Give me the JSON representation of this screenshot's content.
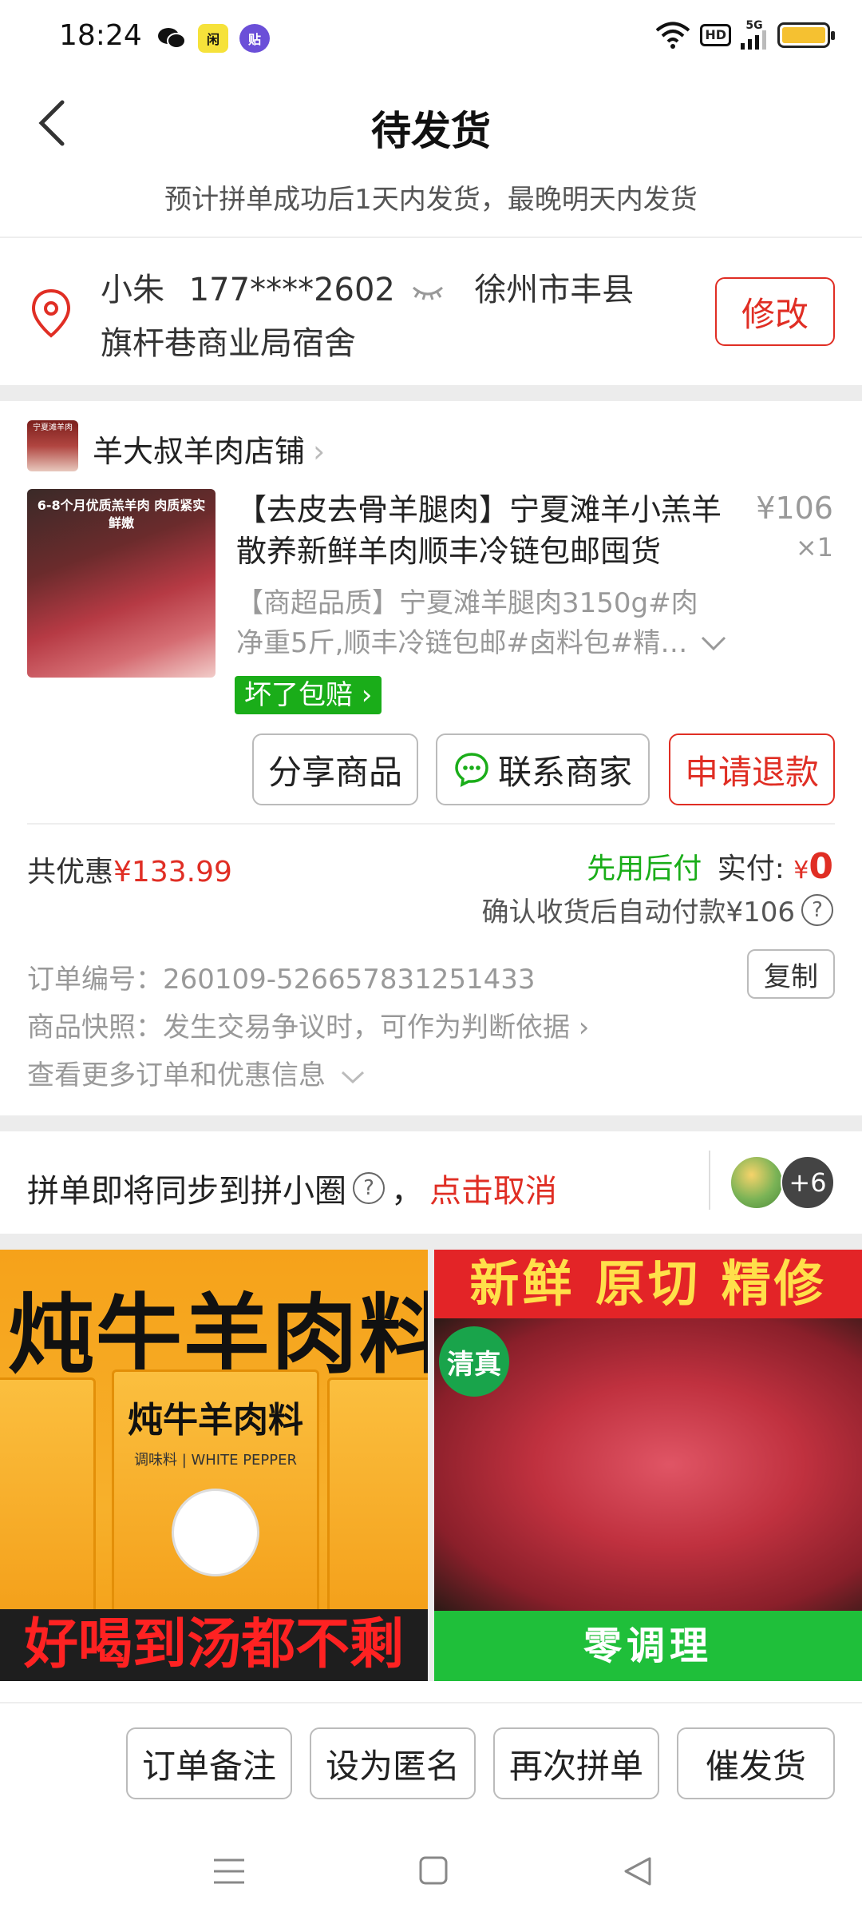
{
  "status_bar": {
    "time": "18:24",
    "hd": "HD",
    "network": "5G",
    "app1": "微",
    "app2": "闲",
    "app3": "贴"
  },
  "header": {
    "title": "待发货",
    "subtitle": "预计拼单成功后1天内发货，最晚明天内发货"
  },
  "address": {
    "name": "小朱",
    "phone": "177****2602",
    "city": "徐州市丰县",
    "detail": "旗杆巷商业局宿舍",
    "modify_label": "修改"
  },
  "shop": {
    "name": "羊大叔羊肉店铺",
    "logo_text": "宁夏滩羊肉"
  },
  "product": {
    "title": "【去皮去骨羊腿肉】宁夏滩羊小羔羊散养新鲜羊肉顺丰冷链包邮囤货",
    "price": "¥106",
    "qty": "×1",
    "sku": "【商超品质】宁夏滩羊腿肉3150g#肉净重5斤,顺丰冷链包邮#卤料包#精…",
    "guarantee": "坏了包赔",
    "image_caption": "6-8个月优质羔羊肉 肉质紧实鲜嫩"
  },
  "actions": {
    "share": "分享商品",
    "contact": "联系商家",
    "refund": "申请退款"
  },
  "payment": {
    "discount_label": "共优惠",
    "discount_value": "¥133.99",
    "pay_later": "先用后付",
    "paid_label": "实付:",
    "paid_currency": "¥",
    "paid_value": "0",
    "auto_pay": "确认收货后自动付款¥106",
    "help": "?"
  },
  "order_meta": {
    "order_no": "订单编号：260109-526657831251433",
    "copy_label": "复制",
    "snapshot": "商品快照：发生交易争议时，可作为判断依据 ›",
    "more": "查看更多订单和优惠信息"
  },
  "group": {
    "text": "拼单即将同步到拼小圈",
    "cancel": "点击取消",
    "comma": "，",
    "count": "+6"
  },
  "recommend": [
    {
      "title": "炖牛羊肉料",
      "pack_title": "炖牛羊肉料",
      "pack_sub": "调味料 | WHITE PEPPER",
      "bottom": "好喝到汤都不剩"
    },
    {
      "top": "新鲜 原切 精修",
      "badge": "清真",
      "bottom": "零调理"
    }
  ],
  "bottom_bar": {
    "note": "订单备注",
    "anonymous": "设为匿名",
    "again": "再次拼单",
    "urge": "催发货"
  },
  "colors": {
    "accent": "#e02e24",
    "green": "#1aad19"
  }
}
